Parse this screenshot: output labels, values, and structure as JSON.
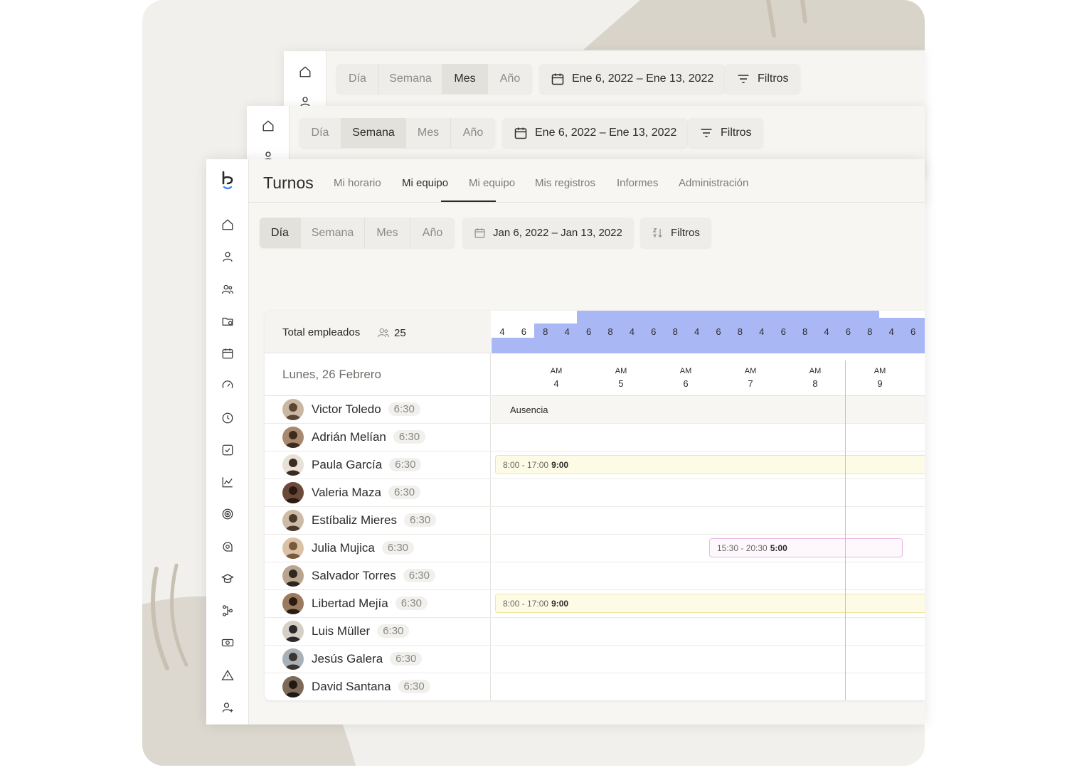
{
  "back_window_1": {
    "views": [
      "Día",
      "Semana",
      "Mes",
      "Año"
    ],
    "selected_view": "Mes",
    "date_range": "Ene 6, 2022 – Ene 13, 2022",
    "filters_label": "Filtros"
  },
  "back_window_2": {
    "views": [
      "Día",
      "Semana",
      "Mes",
      "Año"
    ],
    "selected_view": "Semana",
    "date_range": "Ene 6, 2022 – Ene 13, 2022",
    "filters_label": "Filtros"
  },
  "app": {
    "title": "Turnos",
    "tabs": [
      "Mi horario",
      "Mi equipo",
      "Mi equipo",
      "Mis registros",
      "Informes",
      "Administración"
    ],
    "active_tab_index": 1
  },
  "toolbar": {
    "views": [
      "Día",
      "Semana",
      "Mes",
      "Año"
    ],
    "selected_view": "Día",
    "date_range": "Jan 6, 2022 – Jan 13, 2022",
    "filters_label": "Filtros"
  },
  "sidebar_icons": [
    "home-icon",
    "user-icon",
    "users-icon",
    "folder-icon",
    "calendar-icon",
    "speedometer-icon",
    "clock-icon",
    "checkbox-icon",
    "chart-icon",
    "target-icon",
    "search-chat-icon",
    "graduation-icon",
    "workflow-icon",
    "money-icon",
    "alert-icon",
    "user-add-icon"
  ],
  "schedule": {
    "total_label": "Total empleados",
    "total_count": "25",
    "day_label": "Lunes, 26 Febrero",
    "staffing_counts": [
      "4",
      "6",
      "8",
      "4",
      "6",
      "8",
      "4",
      "6",
      "8",
      "4",
      "6",
      "8",
      "4",
      "6",
      "8",
      "4",
      "6",
      "8",
      "4",
      "6"
    ],
    "hours": [
      {
        "period": "AM",
        "hour": "4"
      },
      {
        "period": "AM",
        "hour": "5"
      },
      {
        "period": "AM",
        "hour": "6"
      },
      {
        "period": "AM",
        "hour": "7"
      },
      {
        "period": "AM",
        "hour": "8"
      },
      {
        "period": "AM",
        "hour": "9"
      }
    ],
    "employees": [
      {
        "name": "Victor Toledo",
        "hours": "6:30"
      },
      {
        "name": "Adrián Melían",
        "hours": "6:30"
      },
      {
        "name": "Paula García",
        "hours": "6:30"
      },
      {
        "name": "Valeria Maza",
        "hours": "6:30"
      },
      {
        "name": "Estíbaliz Mieres",
        "hours": "6:30"
      },
      {
        "name": "Julia Mujica",
        "hours": "6:30"
      },
      {
        "name": "Salvador Torres",
        "hours": "6:30"
      },
      {
        "name": "Libertad Mejía",
        "hours": "6:30"
      },
      {
        "name": "Luis Müller",
        "hours": "6:30"
      },
      {
        "name": "Jesús Galera",
        "hours": "6:30"
      },
      {
        "name": "David Santana",
        "hours": "6:30"
      }
    ],
    "absence_label": "Ausencia",
    "shifts": [
      {
        "row": 2,
        "time": "8:00 - 17:00",
        "duration": "9:00",
        "color": "yellow"
      },
      {
        "row": 5,
        "time": "15:30 - 20:30",
        "duration": "5:00",
        "color": "pink"
      },
      {
        "row": 7,
        "time": "8:00 - 17:00",
        "duration": "9:00",
        "color": "yellow"
      }
    ]
  },
  "colors": {
    "accent_blue": "#a9b8f5",
    "shift_yellow": "#fdfbe6",
    "shift_pink": "#ecb6e6",
    "logo_blue": "#3b82f6"
  }
}
